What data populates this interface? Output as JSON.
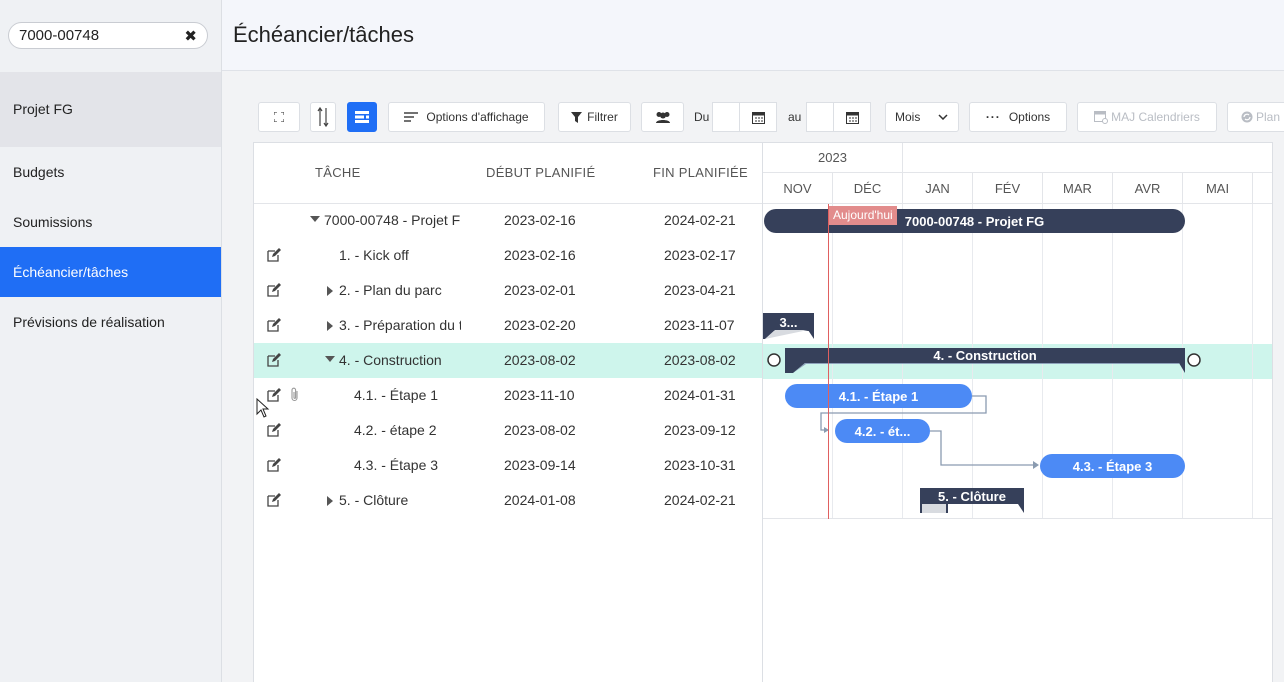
{
  "search": {
    "value": "7000-00748"
  },
  "sidebar": {
    "project": "Projet FG",
    "items": [
      {
        "label": "Budgets"
      },
      {
        "label": "Soumissions"
      },
      {
        "label": "Échéancier/tâches"
      },
      {
        "label": "Prévisions de réalisation"
      }
    ]
  },
  "header": {
    "title": "Échéancier/tâches"
  },
  "toolbar": {
    "display_options": "Options d'affichage",
    "filter": "Filtrer",
    "from_label": "Du",
    "to_label": "au",
    "scale": "Mois",
    "options": "Options",
    "update_calendars": "MAJ Calendriers",
    "plan": "Plan"
  },
  "grid": {
    "headers": {
      "task": "TÂCHE",
      "start": "DÉBUT PLANIFIÉ",
      "end": "FIN PLANIFIÉE"
    },
    "rows": [
      {
        "name": "7000-00748 - Projet FG",
        "start": "2023-02-16",
        "end": "2024-02-21"
      },
      {
        "name": "1. - Kick off",
        "start": "2023-02-16",
        "end": "2023-02-17"
      },
      {
        "name": "2. - Plan du parc",
        "start": "2023-02-01",
        "end": "2023-04-21"
      },
      {
        "name": "3. - Préparation du t",
        "start": "2023-02-20",
        "end": "2023-11-07"
      },
      {
        "name": "4. - Construction",
        "start": "2023-08-02",
        "end": "2023-08-02"
      },
      {
        "name": "4.1. - Étape 1",
        "start": "2023-11-10",
        "end": "2024-01-31"
      },
      {
        "name": "4.2. - étape 2",
        "start": "2023-08-02",
        "end": "2023-09-12"
      },
      {
        "name": "4.3. - Étape 3",
        "start": "2023-09-14",
        "end": "2023-10-31"
      },
      {
        "name": "5. - Clôture",
        "start": "2024-01-08",
        "end": "2024-02-21"
      }
    ]
  },
  "gantt": {
    "year": "2023",
    "months": [
      "NOV",
      "DÉC",
      "JAN",
      "FÉV",
      "MAR",
      "AVR",
      "MAI"
    ],
    "today_label": "Aujourd'hui",
    "bars": {
      "project": "7000-00748 - Projet FG",
      "prep": "3...",
      "construction": "4. - Construction",
      "step1": "4.1. - Étape 1",
      "step2": "4.2. - ét...",
      "step3": "4.3. - Étape 3",
      "closing": "5. - Clôture"
    }
  },
  "colors": {
    "accent": "#1f6ef5",
    "bar_dark": "#36405a",
    "bar_task": "#4c8af5",
    "highlight": "#cef5ec",
    "today": "#e06060"
  }
}
